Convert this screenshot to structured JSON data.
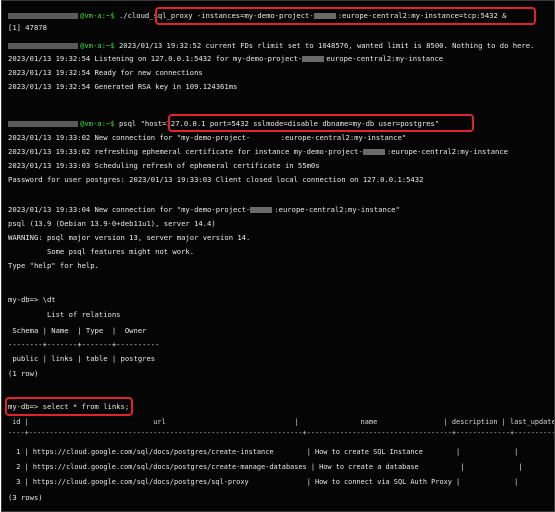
{
  "terminal": {
    "line1_prompt": "@vm-a:~$",
    "line1_cmd_a": "./cloud_sql_proxy -instances=my-demo-project-",
    "line1_cmd_b": ":europe-central2:my-instance=tcp:5432 &",
    "line2": "[1] 47878",
    "line3_prompt": "@vm-a:~$",
    "line3_rest": " 2023/01/13 19:32:52 current FDs rlimit set to 1048576, wanted limit is 8500. Nothing to do here.",
    "line4a": "2023/01/13 19:32:54 Listening on 127.0.0.1:5432 for my-demo-project-",
    "line4b": "europe-central2:my-instance",
    "line5": "2023/01/13 19:32:54 Ready for new connections",
    "line6": "2023/01/13 19:32:54 Generated RSA key in 109.124361ms",
    "line7_prompt": "@vm-a:~$",
    "line7_cmd": "psql \"host=127.0.0.1 port=5432 sslmode=disable dbname=my-db user=postgres\"",
    "line8": "2023/01/13 19:33:02 New connection for \"my-demo-project-       :europe-central2:my-instance\"",
    "line9a": "2023/01/13 19:33:02 refreshing ephemeral certificate for instance my-demo-project-",
    "line9b": ":europe-central2:my-instance",
    "line10": "2023/01/13 19:33:03 Scheduling refresh of ephemeral certificate in 55m0s",
    "line11": "Password for user postgres: 2023/01/13 19:33:03 Client closed local connection on 127.0.0.1:5432",
    "line12a": "2023/01/13 19:33:04 New connection for \"my-demo-project-",
    "line12b": ":europe-central2:my-instance\"",
    "line13": "psql (13.9 (Debian 13.9-0+deb11u1), server 14.4)",
    "line14": "WARNING: psql major version 13, server major version 14.",
    "line15": "         Some psql features might not work.",
    "line16": "Type \"help\" for help.",
    "line17": "my-db=> \\dt",
    "line18": "         List of relations",
    "line19": " Schema | Name  | Type  |  Owner",
    "line20": "--------+-------+-------+----------",
    "line21": " public | links | table | postgres",
    "line22": "(1 row)",
    "line23": "my-db=> select * from links;",
    "tbl_header": " id |                              url                               |               name                | description | last_update",
    "tbl_sep": "----+------------------------------------------------------------------+-----------------------------------+-------------+-------------",
    "rows": [
      "  1 | https://cloud.google.com/sql/docs/postgres/create-instance        | How to create SQL Instance        |             |",
      "  2 | https://cloud.google.com/sql/docs/postgres/create-manage-databases | How to create a database          |             |",
      "  3 | https://cloud.google.com/sql/docs/postgres/sql-proxy              | How to connect via SQL Auth Proxy |             |"
    ],
    "rows_count": "(3 rows)"
  }
}
